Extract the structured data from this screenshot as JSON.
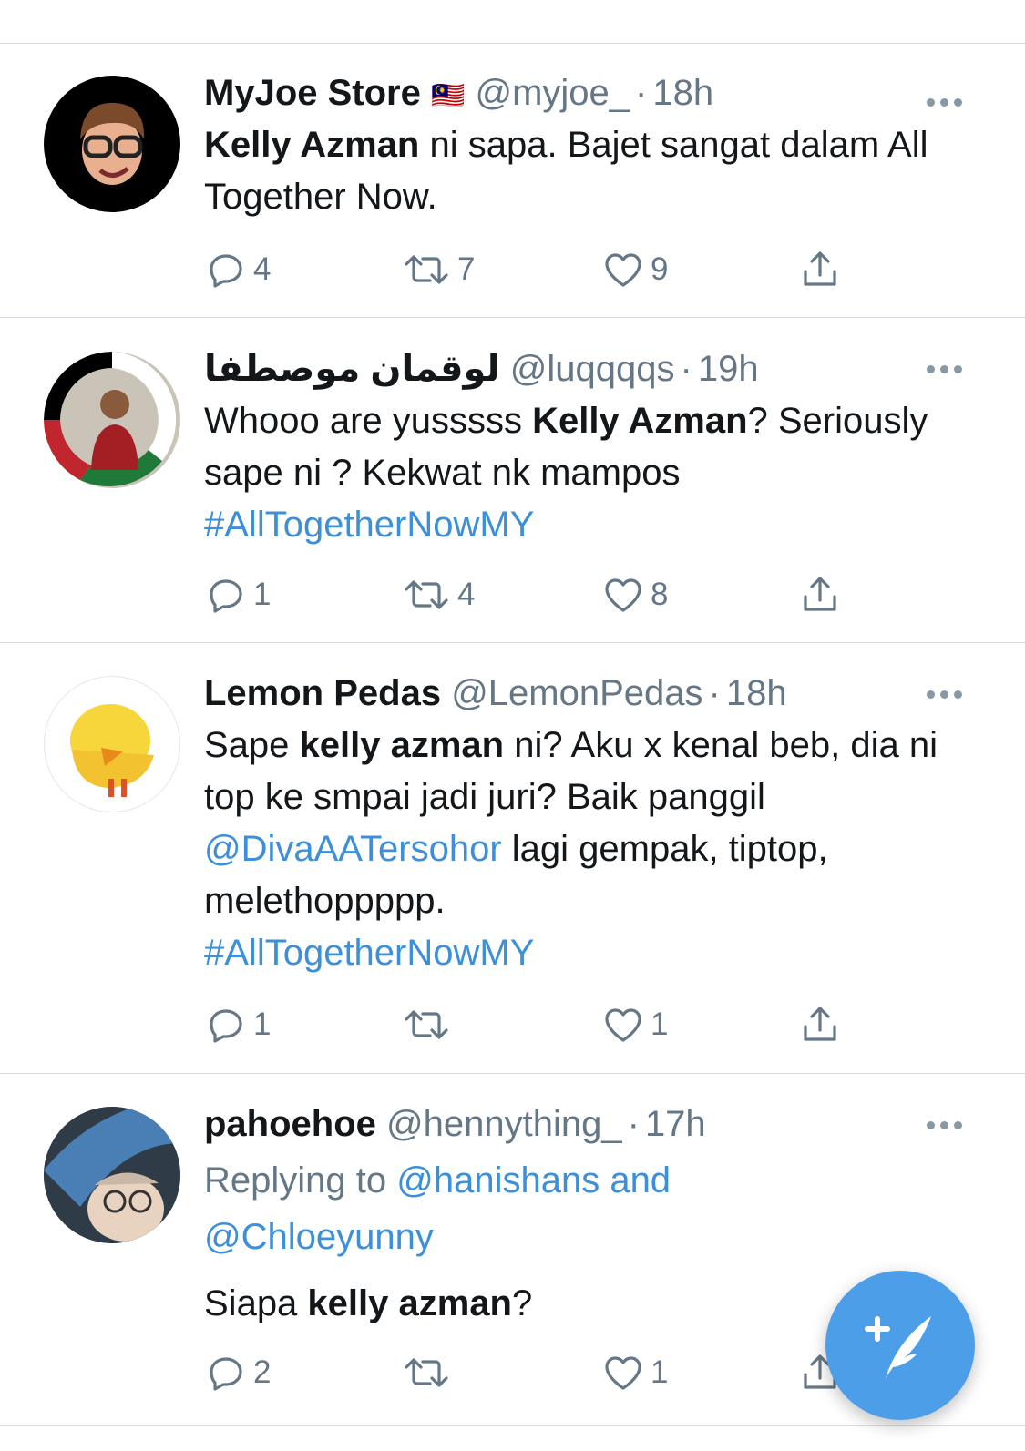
{
  "colors": {
    "accent": "#4c9ee8",
    "link": "#3d8fd9",
    "muted": "#657786",
    "divider": "#d5dbe0"
  },
  "tweets": [
    {
      "name": "MyJoe Store",
      "flag": "🇲🇾",
      "handle": "@myjoe_",
      "time": "18h",
      "text": {
        "b1": "Kelly Azman",
        "t1": " ni sapa. Bajet sangat dalam All Together Now."
      },
      "counts": {
        "reply": "4",
        "retweet": "7",
        "like": "9"
      }
    },
    {
      "name": "لوقمان موصطفا",
      "handle": "@luqqqqs",
      "time": "19h",
      "text": {
        "t1": "Whooo are yusssss ",
        "b1": "Kelly Azman",
        "t2": "? Seriously sape ni ? Kekwat nk mampos",
        "hashtag": "#AllTogetherNowMY"
      },
      "counts": {
        "reply": "1",
        "retweet": "4",
        "like": "8"
      }
    },
    {
      "name": "Lemon Pedas",
      "handle": "@LemonPedas",
      "time": "18h",
      "text": {
        "t1": "Sape ",
        "b1": "kelly azman",
        "t2": " ni? Aku x kenal beb, dia ni top ke smpai jadi juri? Baik panggil ",
        "mention": "@DivaAATersohor",
        "t3": " lagi gempak, tiptop, melethoppppp.",
        "hashtag": "#AllTogetherNowMY"
      },
      "counts": {
        "reply": "1",
        "retweet": "",
        "like": "1"
      }
    },
    {
      "name": "pahoehoe",
      "handle": "@hennything_",
      "time": "17h",
      "reply": {
        "prefix": "Replying to ",
        "users": "@hanishans and",
        "users2": "@Chloeyunny"
      },
      "text": {
        "t1": "Siapa ",
        "b1": "kelly azman",
        "t2": "?"
      },
      "counts": {
        "reply": "2",
        "retweet": "",
        "like": "1"
      }
    }
  ],
  "separator": "·",
  "fab": {
    "icon": "compose-tweet-icon"
  }
}
